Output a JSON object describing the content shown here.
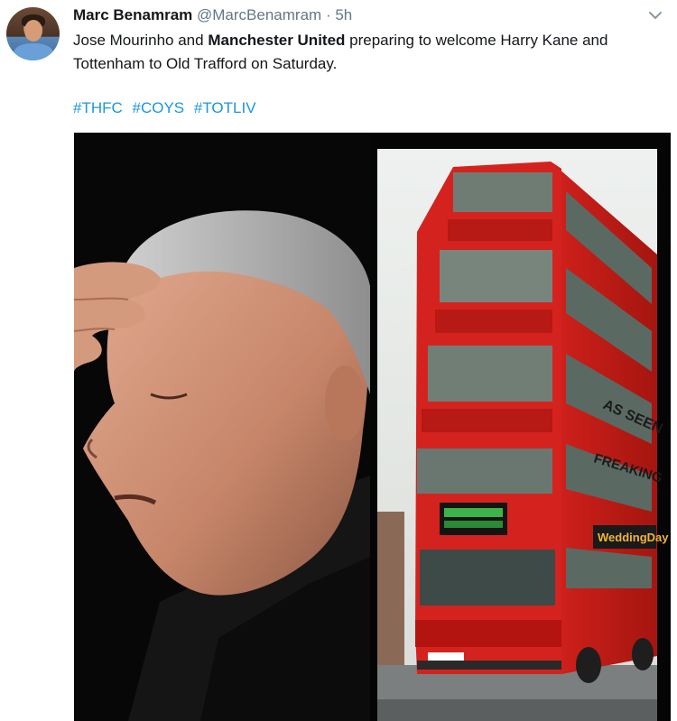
{
  "tweet": {
    "author_name": "Marc Benamram",
    "author_handle": "@MarcBenamram",
    "separator": "·",
    "timestamp": "5h",
    "text_part1": "Jose Mourinho and ",
    "text_bold": "Manchester United",
    "text_part2": " preparing to welcome Harry Kane and Tottenham to Old Trafford on Saturday.",
    "hashtags": [
      "#THFC",
      "#COYS",
      "#TOTLIV"
    ],
    "media": {
      "left_image": "man-holding-forehead",
      "right_image": "triple-decker-red-bus",
      "bus_side_text": "AS SEEN",
      "bus_side_text2": "FREAKING",
      "bus_ad_text": "WeddingDay"
    }
  },
  "colors": {
    "link": "#1b95e0",
    "secondary_text": "#657786",
    "bus_red": "#d4231e"
  },
  "icons": {
    "caret": "chevron-down-icon"
  }
}
